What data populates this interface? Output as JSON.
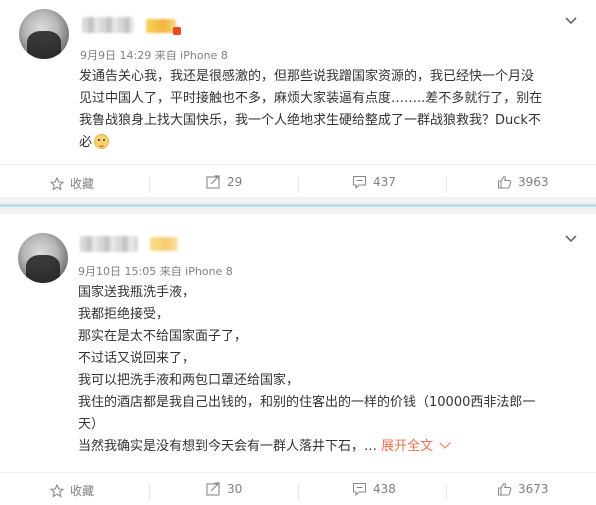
{
  "posts": [
    {
      "meta": "9月9日 14:29 来自 iPhone 8",
      "text_lines": [
        "发通告关心我，我还是很感激的，但那些说我蹭国家资源的，我已经快一个月没",
        "见过中国人了，平时接触也不多，麻烦大家装逼有点度……..差不多就行了，别在",
        "我鲁战狼身上找大国快乐，我一个人绝地求生硬给整成了一群战狼救我？Duck不",
        "必"
      ],
      "emoji_icon": "doge-emoji-icon",
      "actions": {
        "favorite": "收藏",
        "share": "29",
        "comment": "437",
        "like": "3963"
      }
    },
    {
      "meta": "9月10日 15:05 来自 iPhone 8",
      "text_lines": [
        "国家送我瓶洗手液，",
        "我都拒绝接受，",
        "那实在是太不给国家面子了，",
        "不过话又说回来了，",
        "我可以把洗手液和两包口罩还给国家，",
        "我住的酒店都是我自己出钱的，和别的住客出的一样的价钱（10000西非法郎一",
        "天）",
        "当然我确实是没有想到今天会有一群人落井下石，"
      ],
      "ellipsis": "…",
      "expand_label": "展开全文",
      "actions": {
        "favorite": "收藏",
        "share": "30",
        "comment": "438",
        "like": "3673"
      }
    }
  ],
  "colors": {
    "text": "#333333",
    "meta": "#808080",
    "expand_link": "#eb7350",
    "separator": "#f2f2f5",
    "separator_bar": "#bcdceb"
  }
}
